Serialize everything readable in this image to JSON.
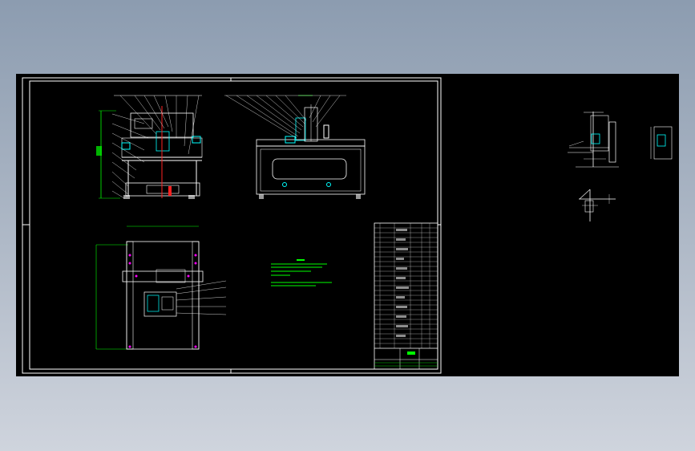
{
  "app": {
    "viewport_background": "#000000",
    "window_background": "#9aa7b8"
  },
  "drawing": {
    "line_colors": {
      "border": "#ffffff",
      "dimension": "#00ff00",
      "part": "#ffffff",
      "center_line": "#ff2020",
      "highlight": "#00ffff",
      "accent": "#ff00ff"
    }
  }
}
